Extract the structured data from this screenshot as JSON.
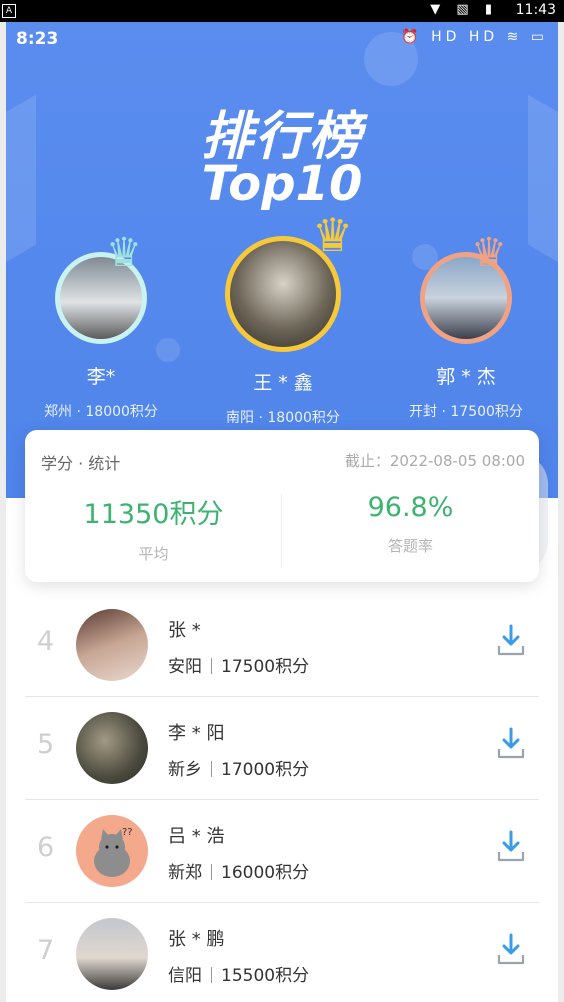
{
  "system_bar": {
    "left_icon": "A",
    "time": "11:43",
    "icons": "▼ ▧ ▮"
  },
  "status_bar": {
    "time": "8:23",
    "icons": "⏰ HD HD ≋ ▭"
  },
  "title_cn": "排行榜",
  "title_en": "Top10",
  "podium": [
    {
      "name": "李*",
      "meta": "郑州 · 18000积分",
      "crown_color": "#9fe0e0",
      "ring_color": "#c9f2f2"
    },
    {
      "name": "王 * 鑫",
      "meta": "南阳 · 18000积分",
      "crown_color": "#f6c93b",
      "ring_color": "#f6c93b"
    },
    {
      "name": "郭 * 杰",
      "meta": "开封 · 17500积分",
      "crown_color": "#f0a384",
      "ring_color": "#f0a384"
    }
  ],
  "stats": {
    "label": "学分 · 统计",
    "deadline": "截止：2022-08-05 08:00",
    "average_value": "11350积分",
    "average_caption": "平均",
    "rate_value": "96.8%",
    "rate_caption": "答题率"
  },
  "colors": {
    "hero_blue": "#5b8def",
    "stat_green": "#3cb371",
    "download_blue": "#3a9be8"
  },
  "rankings": [
    {
      "rank": "4",
      "name": "张 *",
      "city": "安阳",
      "score": "17500积分"
    },
    {
      "rank": "5",
      "name": "李 * 阳",
      "city": "新乡",
      "score": "17000积分"
    },
    {
      "rank": "6",
      "name": "吕 * 浩",
      "city": "新郑",
      "score": "16000积分"
    },
    {
      "rank": "7",
      "name": "张 * 鹏",
      "city": "信阳",
      "score": "15500积分"
    }
  ]
}
